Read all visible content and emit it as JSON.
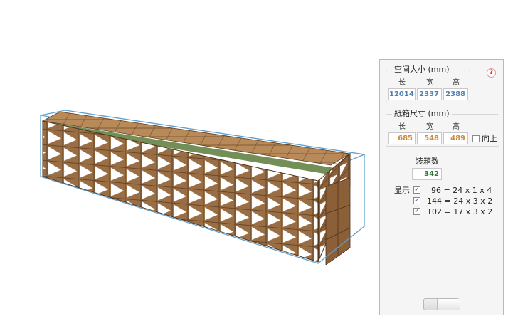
{
  "space": {
    "title": "空间大小 (mm)",
    "headers": [
      "长",
      "宽",
      "高"
    ],
    "values": [
      "12014",
      "2337",
      "2388"
    ]
  },
  "carton": {
    "title": "紙箱尺寸 (mm)",
    "headers": [
      "长",
      "宽",
      "高"
    ],
    "values": [
      "685",
      "548",
      "489"
    ],
    "upright_label": "向上",
    "upright_checked": false
  },
  "count": {
    "label": "装箱数",
    "value": "342"
  },
  "display": {
    "label": "显示",
    "rows": [
      {
        "checked": true,
        "text": "96 = 24 x 1 x 4"
      },
      {
        "checked": true,
        "text": "144 = 24 x 3 x 2"
      },
      {
        "checked": true,
        "text": "102 = 17 x 3 x 2"
      }
    ]
  },
  "help_icon": "question-icon",
  "colors": {
    "carton_top": "#b88a5a",
    "carton_side": "#8b6038",
    "carton_front": "#9a6e44",
    "carton_print": "#ffffff",
    "container_outline": "#5fa0cf",
    "space_values": "#4e7fb0",
    "carton_values": "#c98a3e",
    "count_value": "#2e7d32"
  }
}
